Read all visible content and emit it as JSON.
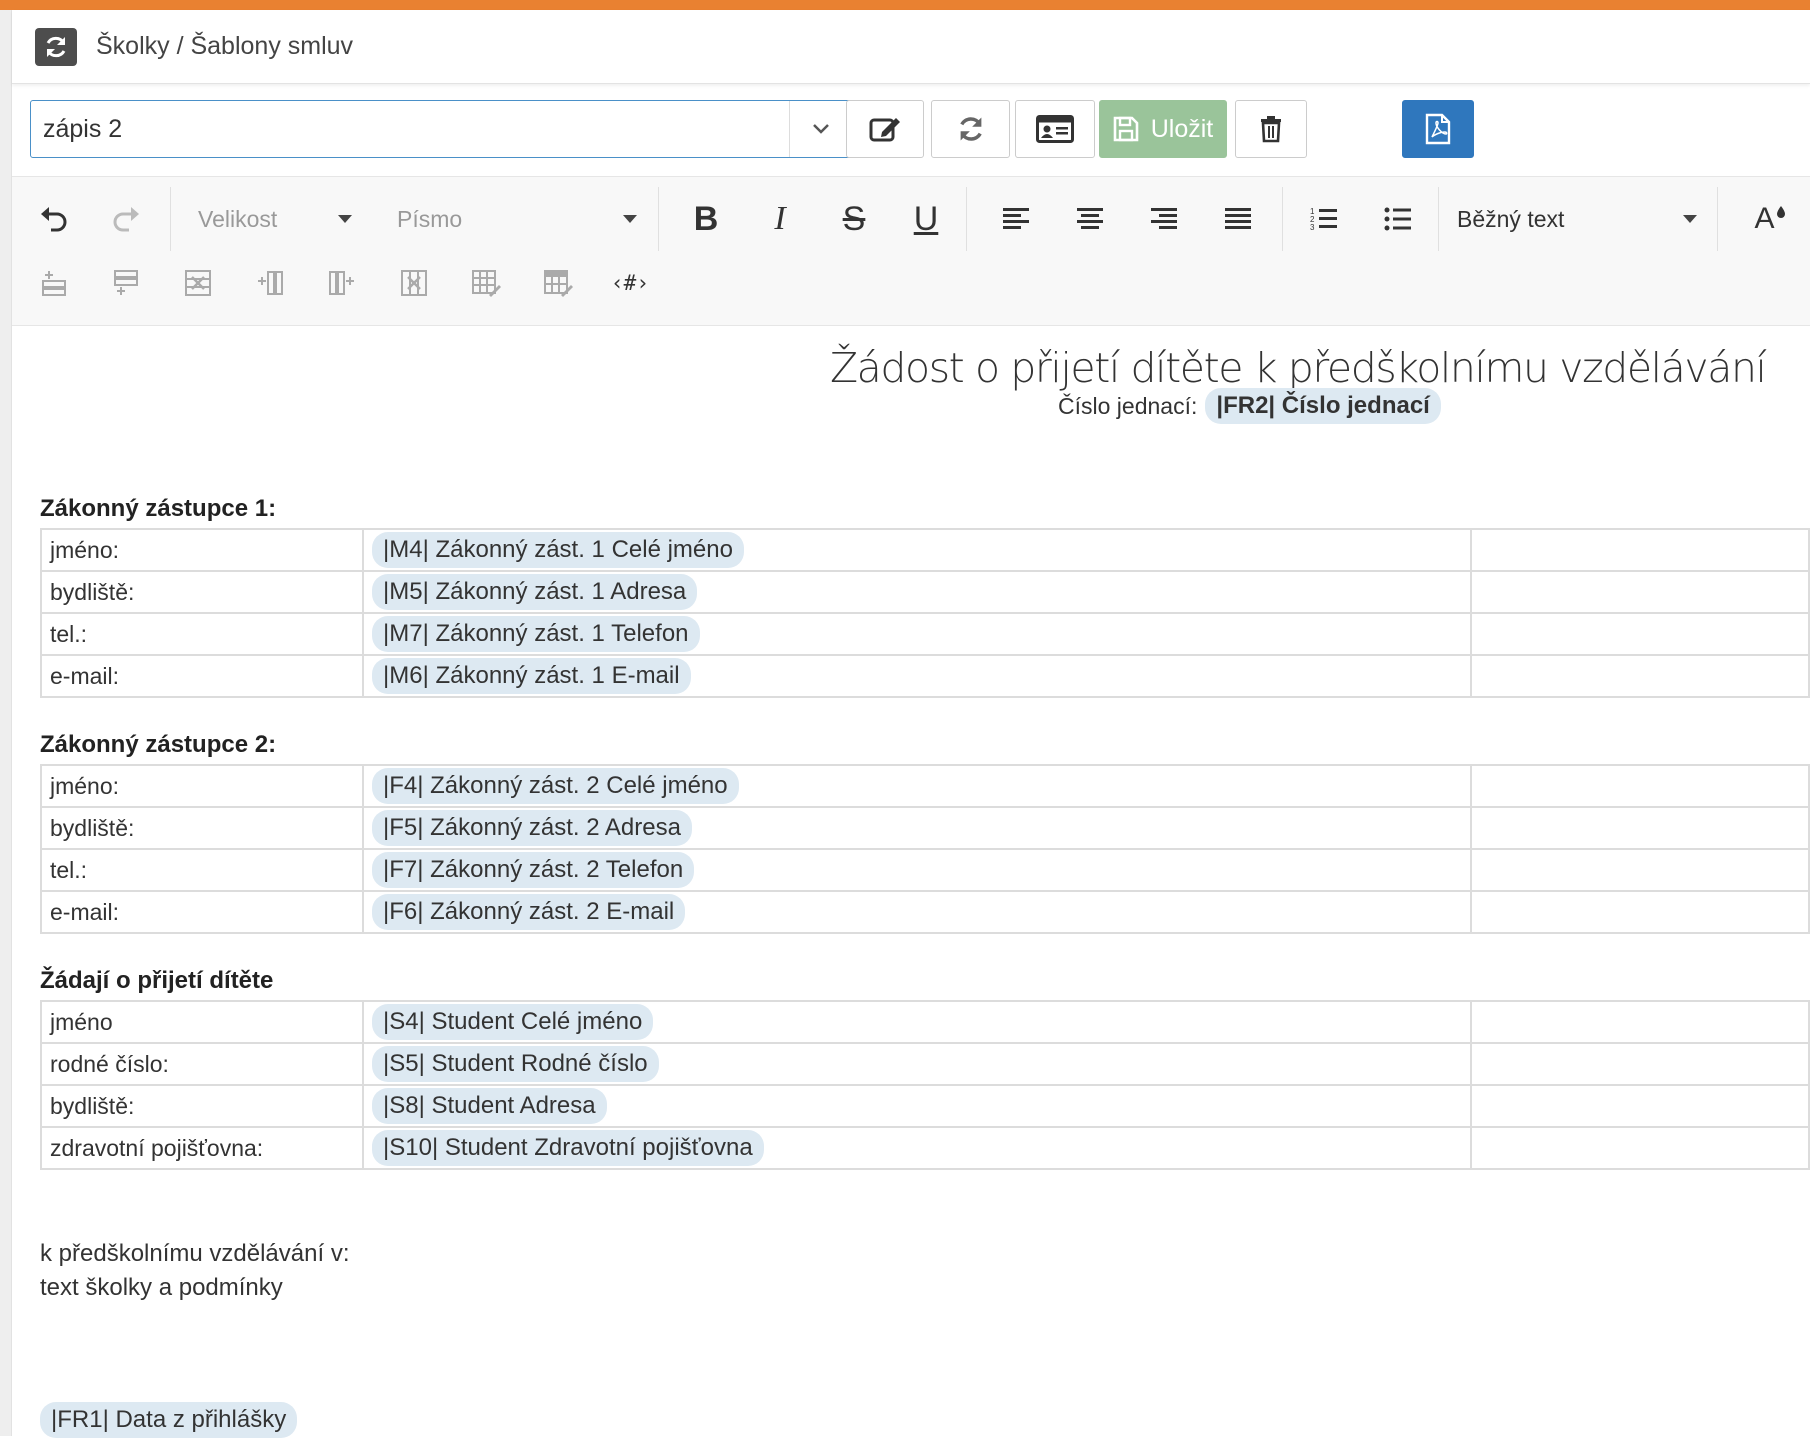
{
  "header": {
    "breadcrumb": "Školky / Šablony smluv"
  },
  "template_bar": {
    "selected_template": "zápis 2",
    "save_label": "Uložit"
  },
  "editor_toolbar": {
    "size_placeholder": "Velikost",
    "font_placeholder": "Písmo",
    "paragraph_style": "Běžný text",
    "bold_glyph": "B",
    "italic_glyph": "I",
    "strike_glyph": "S",
    "underline_glyph": "U",
    "font_color_glyph": "A",
    "placeholder_tag": "‹#›"
  },
  "document": {
    "title": "Žádost o přijetí dítěte k předškolnímu vzdělávání",
    "ref_label": "Číslo jednací:",
    "ref_chip": "|FR2| Číslo jednací",
    "sections": [
      {
        "title": "Zákonný zástupce 1:",
        "rows": [
          {
            "label": "jméno:",
            "value": "|M4| Zákonný zást. 1 Celé jméno"
          },
          {
            "label": "bydliště:",
            "value": "|M5| Zákonný zást. 1 Adresa"
          },
          {
            "label": "tel.:",
            "value": "|M7| Zákonný zást. 1 Telefon"
          },
          {
            "label": "e-mail:",
            "value": "|M6| Zákonný zást. 1 E-mail"
          }
        ]
      },
      {
        "title": "Zákonný zástupce 2:",
        "rows": [
          {
            "label": "jméno:",
            "value": "|F4| Zákonný zást. 2 Celé jméno"
          },
          {
            "label": "bydliště:",
            "value": "|F5| Zákonný zást. 2 Adresa"
          },
          {
            "label": "tel.:",
            "value": "|F7| Zákonný zást. 2 Telefon"
          },
          {
            "label": "e-mail:",
            "value": "|F6| Zákonný zást. 2 E-mail"
          }
        ]
      },
      {
        "title": "Žádají o přijetí dítěte",
        "rows": [
          {
            "label": "jméno",
            "value": "|S4| Student Celé jméno"
          },
          {
            "label": "rodné číslo:",
            "value": "|S5| Student Rodné číslo"
          },
          {
            "label": "bydliště:",
            "value": "|S8| Student Adresa"
          },
          {
            "label": "zdravotní pojišťovna:",
            "value": "|S10| Student Zdravotní pojišťovna"
          }
        ]
      }
    ],
    "paragraph_line1": "k předškolnímu vzdělávání v:",
    "paragraph_line2": "text školky a podmínky",
    "footer_chip": "|FR1| Data z přihlášky"
  },
  "colors": {
    "accent_orange": "#e98131",
    "primary_blue": "#2f77bd",
    "save_green": "#9ac49a",
    "chip_bg": "#dde9f2"
  }
}
